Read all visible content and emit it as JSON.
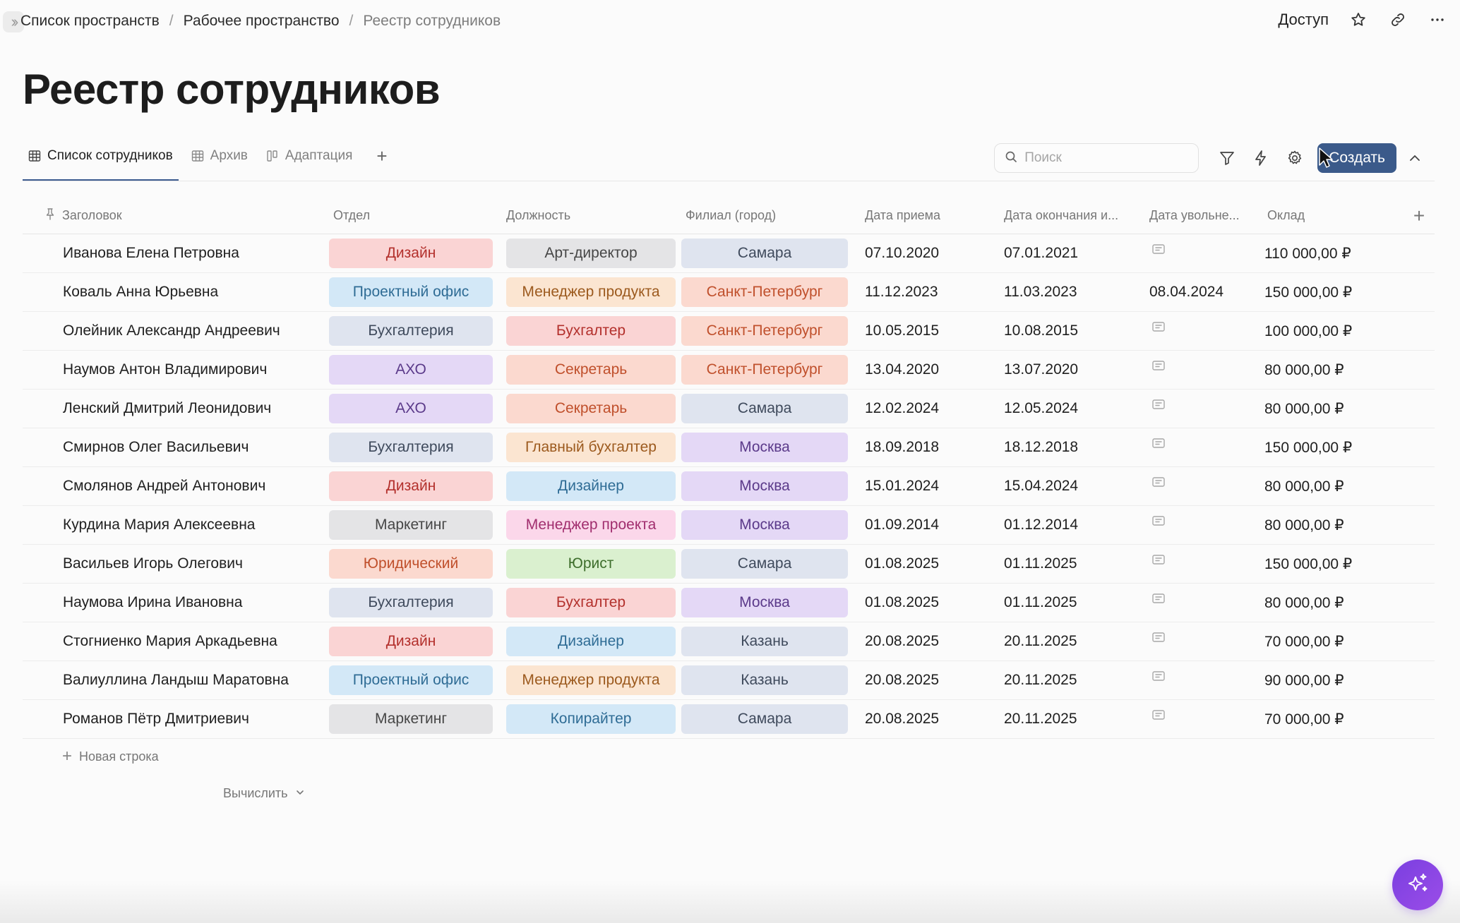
{
  "breadcrumb": {
    "items": [
      "Список пространств",
      "Рабочее пространство"
    ],
    "separator": "/",
    "current": "Реестр сотрудников"
  },
  "header": {
    "access_label": "Доступ"
  },
  "page": {
    "title": "Реестр сотрудников"
  },
  "tabs": [
    {
      "label": "Список сотрудников",
      "icon": "table-grid-icon",
      "active": true
    },
    {
      "label": "Архив",
      "icon": "table-grid-icon",
      "active": false
    },
    {
      "label": "Адаптация",
      "icon": "kanban-board-icon",
      "active": false
    }
  ],
  "toolbar": {
    "search_placeholder": "Поиск",
    "create_label": "Создать"
  },
  "table": {
    "columns": [
      "Заголовок",
      "Отдел",
      "Должность",
      "Филиал (город)",
      "Дата приема",
      "Дата окончания и...",
      "Дата увольне...",
      "Оклад"
    ],
    "rows": [
      {
        "title": "Иванова Елена Петровна",
        "dept": "Дизайн",
        "pos": "Арт-директор",
        "city": "Самара",
        "hire": "07.10.2020",
        "end": "07.01.2021",
        "fire": "",
        "salary": "110 000,00 ₽"
      },
      {
        "title": "Коваль Анна Юрьевна",
        "dept": "Проектный офис",
        "pos": "Менеджер продукта",
        "city": "Санкт-Петербург",
        "hire": "11.12.2023",
        "end": "11.03.2023",
        "fire": "08.04.2024",
        "salary": "150 000,00 ₽"
      },
      {
        "title": "Олейник Александр Андреевич",
        "dept": "Бухгалтерия",
        "pos": "Бухгалтер",
        "city": "Санкт-Петербург",
        "hire": "10.05.2015",
        "end": "10.08.2015",
        "fire": "",
        "salary": "100 000,00 ₽"
      },
      {
        "title": "Наумов Антон Владимирович",
        "dept": "АХО",
        "pos": "Секретарь",
        "city": "Санкт-Петербург",
        "hire": "13.04.2020",
        "end": "13.07.2020",
        "fire": "",
        "salary": "80 000,00 ₽"
      },
      {
        "title": "Ленский Дмитрий Леонидович",
        "dept": "АХО",
        "pos": "Секретарь",
        "city": "Самара",
        "hire": "12.02.2024",
        "end": "12.05.2024",
        "fire": "",
        "salary": "80 000,00 ₽"
      },
      {
        "title": "Смирнов Олег Васильевич",
        "dept": "Бухгалтерия",
        "pos": "Главный бухгалтер",
        "city": "Москва",
        "hire": "18.09.2018",
        "end": "18.12.2018",
        "fire": "",
        "salary": "150 000,00 ₽"
      },
      {
        "title": "Смолянов Андрей Антонович",
        "dept": "Дизайн",
        "pos": "Дизайнер",
        "city": "Москва",
        "hire": "15.01.2024",
        "end": "15.04.2024",
        "fire": "",
        "salary": "80 000,00 ₽"
      },
      {
        "title": "Курдина Мария Алексеевна",
        "dept": "Маркетинг",
        "pos": "Менеджер проекта",
        "city": "Москва",
        "hire": "01.09.2014",
        "end": "01.12.2014",
        "fire": "",
        "salary": "80 000,00 ₽"
      },
      {
        "title": "Васильев Игорь Олегович",
        "dept": "Юридический",
        "pos": "Юрист",
        "city": "Самара",
        "hire": "01.08.2025",
        "end": "01.11.2025",
        "fire": "",
        "salary": "150 000,00 ₽"
      },
      {
        "title": "Наумова Ирина Ивановна",
        "dept": "Бухгалтерия",
        "pos": "Бухгалтер",
        "city": "Москва",
        "hire": "01.08.2025",
        "end": "01.11.2025",
        "fire": "",
        "salary": "80 000,00 ₽"
      },
      {
        "title": "Стогниенко Мария Аркадьевна",
        "dept": "Дизайн",
        "pos": "Дизайнер",
        "city": "Казань",
        "hire": "20.08.2025",
        "end": "20.11.2025",
        "fire": "",
        "salary": "70 000,00 ₽"
      },
      {
        "title": "Валиуллина Ландыш Маратовна",
        "dept": "Проектный офис",
        "pos": "Менеджер продукта",
        "city": "Казань",
        "hire": "20.08.2025",
        "end": "20.11.2025",
        "fire": "",
        "salary": "90 000,00 ₽"
      },
      {
        "title": "Романов Пётр Дмитриевич",
        "dept": "Маркетинг",
        "pos": "Копирайтер",
        "city": "Самара",
        "hire": "20.08.2025",
        "end": "20.11.2025",
        "fire": "",
        "salary": "70 000,00 ₽"
      }
    ],
    "new_row_label": "Новая строка",
    "calculate_label": "Вычислить"
  },
  "tag_colors": {
    "Дизайн": {
      "bg": "#fad4d4",
      "fg": "#b3302c"
    },
    "Проектный офис": {
      "bg": "#d3e8f7",
      "fg": "#2f6c95"
    },
    "Бухгалтерия": {
      "bg": "#dfe4ef",
      "fg": "#3f4a5c"
    },
    "АХО": {
      "bg": "#e4d8f6",
      "fg": "#5b3a8a"
    },
    "Маркетинг": {
      "bg": "#e4e4e6",
      "fg": "#464646"
    },
    "Юридический": {
      "bg": "#fbd9cf",
      "fg": "#c0502c"
    },
    "Арт-директор": {
      "bg": "#e4e4e6",
      "fg": "#464646"
    },
    "Менеджер продукта": {
      "bg": "#fbe5d1",
      "fg": "#9c5a1e"
    },
    "Бухгалтер": {
      "bg": "#fad4d4",
      "fg": "#b3302c"
    },
    "Секретарь": {
      "bg": "#fbd9cf",
      "fg": "#c0502c"
    },
    "Главный бухгалтер": {
      "bg": "#fbe5d1",
      "fg": "#9c5a1e"
    },
    "Дизайнер": {
      "bg": "#d3e8f7",
      "fg": "#2f6c95"
    },
    "Менеджер проекта": {
      "bg": "#fbd7ea",
      "fg": "#a12e6e"
    },
    "Юрист": {
      "bg": "#daf0cf",
      "fg": "#3e6e2c"
    },
    "Копирайтер": {
      "bg": "#d3e8f7",
      "fg": "#2f6c95"
    },
    "Самара": {
      "bg": "#dfe4ef",
      "fg": "#3f4a5c"
    },
    "Санкт-Петербург": {
      "bg": "#fbd9cf",
      "fg": "#c0502c"
    },
    "Москва": {
      "bg": "#e4d8f6",
      "fg": "#5b3a8a"
    },
    "Казань": {
      "bg": "#dfe4ef",
      "fg": "#3f4a5c"
    }
  },
  "colors": {
    "accent": "#3b5a8a",
    "ai_button": "#8a46e6"
  }
}
